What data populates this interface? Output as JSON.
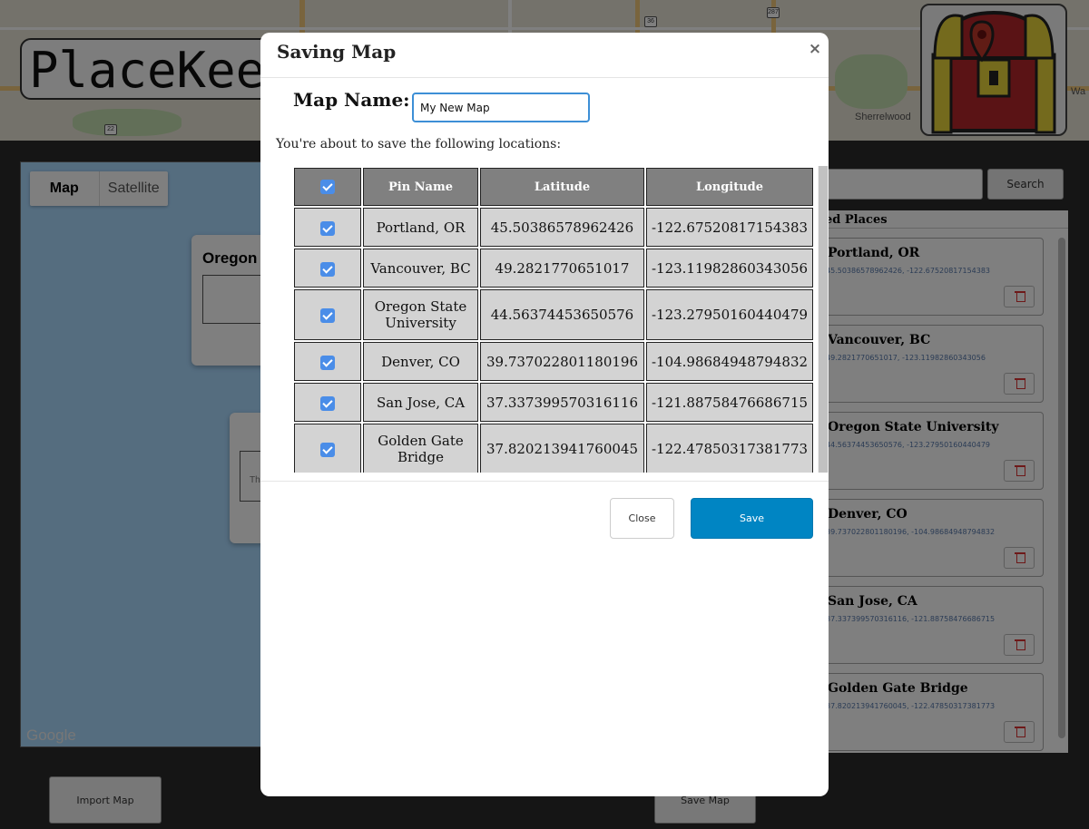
{
  "app": {
    "logo_text": "PlaceKeeper",
    "map_labels": [
      "Sherrelwood",
      "Wa"
    ],
    "highway_shields": [
      "36",
      "287",
      "22"
    ]
  },
  "map": {
    "tabs": [
      {
        "label": "Map",
        "active": true
      },
      {
        "label": "Satellite",
        "active": false
      }
    ],
    "info_card_title": "Oregon S",
    "info_card_snippet": "Th",
    "google_logo": "Google"
  },
  "sidebar": {
    "search_button_label": "Search",
    "header": "ed Places",
    "places": [
      {
        "name": "Portland, OR",
        "coords": "45.50386578962426, -122.67520817154383"
      },
      {
        "name": "Vancouver, BC",
        "coords": "49.2821770651017, -123.11982860343056"
      },
      {
        "name": "Oregon State University",
        "coords": "44.56374453650576, -123.27950160440479"
      },
      {
        "name": "Denver, CO",
        "coords": "39.737022801180196, -104.98684948794832"
      },
      {
        "name": "San Jose, CA",
        "coords": "37.337399570316116, -121.88758476686715"
      },
      {
        "name": "Golden Gate Bridge",
        "coords": "37.820213941760045, -122.47850317381773"
      }
    ]
  },
  "bottom": {
    "import_label": "Import Map",
    "save_label": "Save Map"
  },
  "modal": {
    "title": "Saving Map",
    "close_glyph": "×",
    "name_label": "Map Name:",
    "name_value": "My New Map",
    "intro": "You're about to save the following locations:",
    "columns": [
      "Pin Name",
      "Latitude",
      "Longitude"
    ],
    "rows": [
      {
        "checked": true,
        "name": "Portland, OR",
        "lat": "45.50386578962426",
        "lng": "-122.67520817154383"
      },
      {
        "checked": true,
        "name": "Vancouver, BC",
        "lat": "49.2821770651017",
        "lng": "-123.11982860343056"
      },
      {
        "checked": true,
        "name": "Oregon State University",
        "lat": "44.56374453650576",
        "lng": "-123.27950160440479"
      },
      {
        "checked": true,
        "name": "Denver, CO",
        "lat": "39.737022801180196",
        "lng": "-104.98684948794832"
      },
      {
        "checked": true,
        "name": "San Jose, CA",
        "lat": "37.337399570316116",
        "lng": "-121.88758476686715"
      },
      {
        "checked": true,
        "name": "Golden Gate Bridge",
        "lat": "37.820213941760045",
        "lng": "-122.47850317381773"
      }
    ],
    "close_button": "Close",
    "save_button": "Save"
  },
  "colors": {
    "save_button": "#0085c3",
    "checkbox": "#4a8de8",
    "header_cell": "#808080",
    "body_cell": "#d3d3d3",
    "input_focus": "#3d8fd6"
  },
  "icons": {
    "close": "close-icon",
    "checkbox": "checkbox-checked-icon",
    "delete": "trash-icon",
    "logo": "treasure-chest-pin-icon"
  }
}
